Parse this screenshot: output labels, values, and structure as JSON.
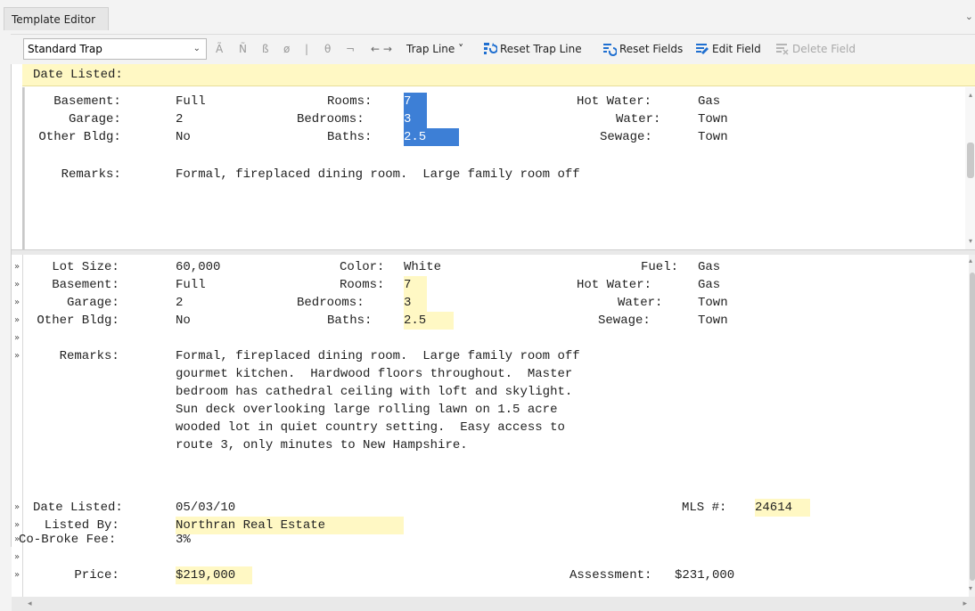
{
  "window": {
    "tab_title": "Template Editor",
    "tab_menu_icon": "chevron-down-icon"
  },
  "toolbar": {
    "template_select": "Standard Trap",
    "char_buttons": [
      "Ã",
      "Ñ",
      "ß",
      "ø",
      "|",
      "θ",
      "¬"
    ],
    "arrows": "← →",
    "trap_line_label": "Trap Line ˅",
    "reset_trap_line": "Reset Trap Line",
    "reset_fields": "Reset Fields",
    "edit_field": "Edit Field",
    "delete_field": "Delete Field"
  },
  "banner": {
    "text": "Date Listed:"
  },
  "pane1": {
    "lines": [
      {
        "l1": "   Basement:",
        "v1": "Full",
        "l2": "Rooms:",
        "v2": "7",
        "l3": "Hot Water:",
        "v3": "Gas"
      },
      {
        "l1": "     Garage:",
        "v1": "2",
        "l2": "Bedrooms:",
        "v2": "3",
        "l3": "Water:",
        "v3": "Town"
      },
      {
        "l1": " Other Bldg:",
        "v1": "No",
        "l2": "Baths:",
        "v2": "2.5",
        "l3": "Sewage:",
        "v3": "Town"
      }
    ],
    "remarks_label": "    Remarks:",
    "remarks_text": "Formal, fireplaced dining room.  Large family room off"
  },
  "pane2": {
    "lines": [
      {
        "l1": "   Lot Size:",
        "v1": "60,000",
        "l2": "Color:",
        "v2": "White",
        "l3": "Fuel:",
        "v3": "Gas"
      },
      {
        "l1": "   Basement:",
        "v1": "Full",
        "l2": "Rooms:",
        "v2": "7",
        "l3": "Hot Water:",
        "v3": "Gas"
      },
      {
        "l1": "     Garage:",
        "v1": "2",
        "l2": "Bedrooms:",
        "v2": "3",
        "l3": "Water:",
        "v3": "Town"
      },
      {
        "l1": " Other Bldg:",
        "v1": "No",
        "l2": "Baths:",
        "v2": "2.5",
        "l3": "Sewage:",
        "v3": "Town"
      }
    ],
    "remarks_label": "    Remarks:",
    "remarks_lines": [
      "Formal, fireplaced dining room.  Large family room off",
      "gourmet kitchen.  Hardwood floors throughout.  Master",
      "bedroom has cathedral ceiling with loft and skylight.",
      "Sun deck overlooking large rolling lawn on 1.5 acre",
      "wooded lot in quiet country setting.  Easy access to",
      "route 3, only minutes to New Hampshire."
    ],
    "date_label": "Date Listed:",
    "date_value": "05/03/10",
    "mls_label": "MLS #:",
    "mls_value": "24614",
    "listed_by_label": "  Listed By:",
    "listed_by_value": "Northran Real Estate",
    "cobroke_label": "Co-Broke Fee:",
    "cobroke_value": "3%",
    "price_label": "      Price:",
    "price_value": "$219,000",
    "assessment_label": "Assessment:",
    "assessment_value": "$231,000",
    "gutter_marker": "»"
  },
  "colors": {
    "selection": "#3d7fd6",
    "highlight": "#fff8c4",
    "icon_blue": "#1f6fd0"
  }
}
